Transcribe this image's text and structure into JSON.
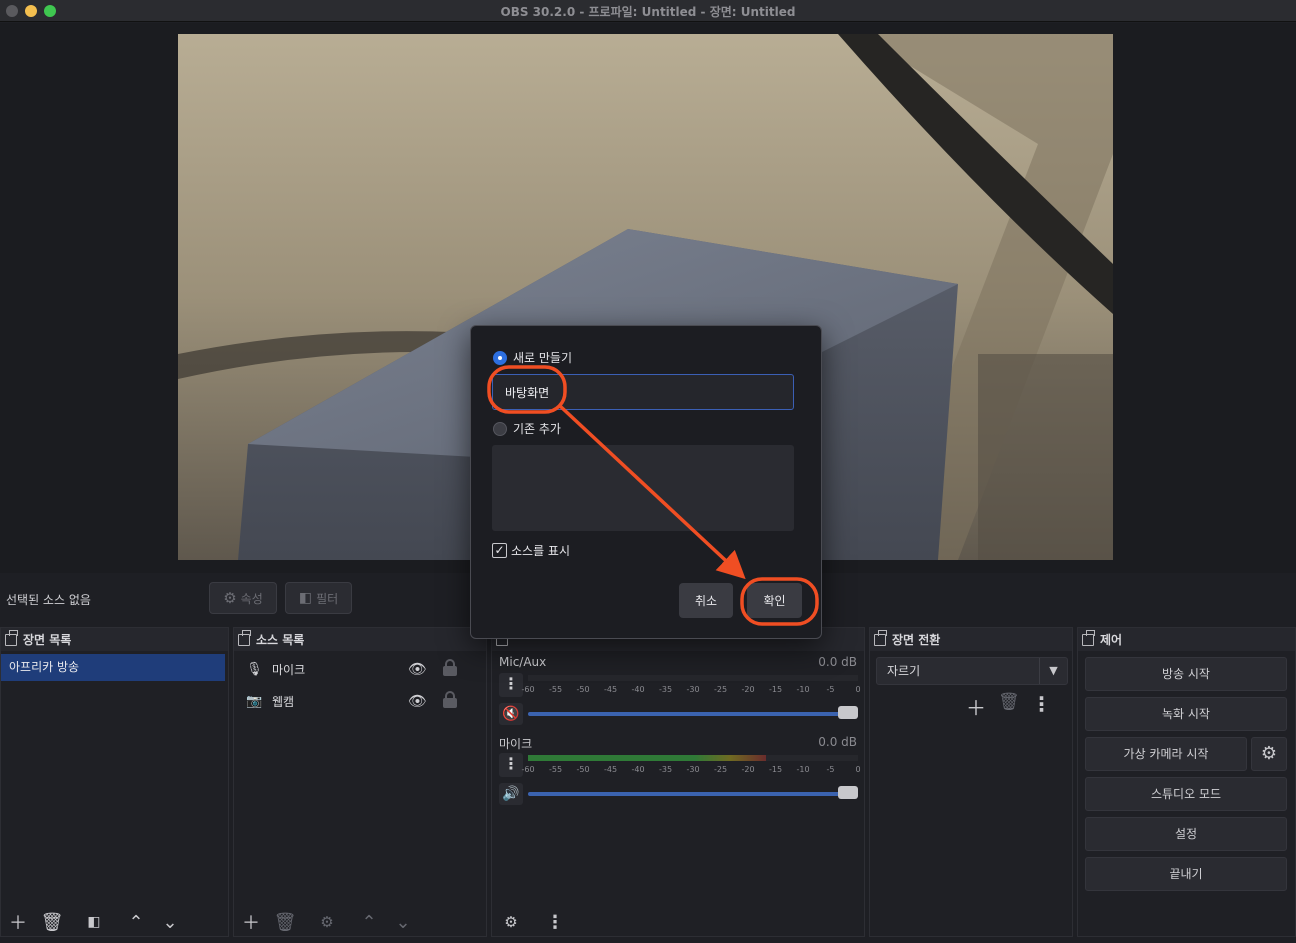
{
  "window": {
    "title": "OBS 30.2.0 - 프로파일: Untitled - 장면: Untitled"
  },
  "context_bar": {
    "no_source": "선택된 소스 없음",
    "properties": "속성",
    "filters": "필터"
  },
  "scenes": {
    "title": "장면 목록",
    "items": [
      "아프리카 방송"
    ]
  },
  "sources": {
    "title": "소스 목록",
    "items": [
      {
        "label": "마이크",
        "icon": "microphone-icon"
      },
      {
        "label": "웹캠",
        "icon": "camera-icon"
      }
    ]
  },
  "mixer": {
    "channels": [
      {
        "name": "Mic/Aux",
        "db": "0.0 dB",
        "muted": true,
        "level": 0.0
      },
      {
        "name": "마이크",
        "db": "0.0 dB",
        "muted": false,
        "level": 0.72
      }
    ],
    "scale": [
      "-60",
      "-55",
      "-50",
      "-45",
      "-40",
      "-35",
      "-30",
      "-25",
      "-20",
      "-15",
      "-10",
      "-5",
      "0"
    ]
  },
  "transitions": {
    "title": "장면 전환",
    "selected": "자르기"
  },
  "controls": {
    "title": "제어",
    "start_stream": "방송 시작",
    "start_record": "녹화 시작",
    "start_virtual_cam": "가상 카메라 시작",
    "studio_mode": "스튜디오 모드",
    "settings": "설정",
    "exit": "끝내기"
  },
  "dialog": {
    "create_new": "새로 만들기",
    "name_value": "바탕화면",
    "add_existing": "기존 추가",
    "make_visible": "소스를 표시",
    "cancel": "취소",
    "ok": "확인"
  },
  "colors": {
    "accent": "#2d6fe0",
    "annotation": "#f04e23",
    "scene_selected": "#1f3d7a"
  }
}
